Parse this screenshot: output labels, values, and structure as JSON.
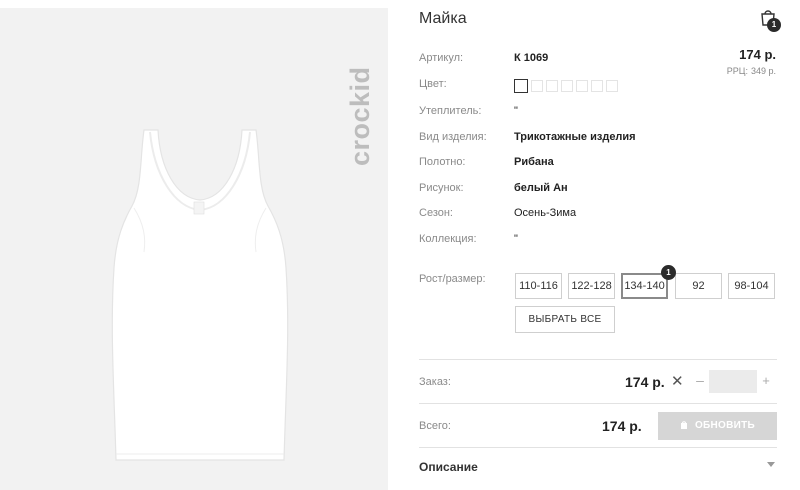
{
  "product": {
    "title": "Майка",
    "brand": "crockid",
    "price": "174 р.",
    "rrp_label": "РРЦ:",
    "rrp_value": "349 р."
  },
  "cart": {
    "badge_count": "1"
  },
  "attributes": [
    {
      "label": "Артикул:",
      "value": "К 1069",
      "bold": true
    },
    {
      "label": "Цвет:",
      "value": ""
    },
    {
      "label": "Утеплитель:",
      "value": "\""
    },
    {
      "label": "Вид изделия:",
      "value": "Трикотажные изделия",
      "bold": true
    },
    {
      "label": "Полотно:",
      "value": "Рибана",
      "bold": true
    },
    {
      "label": "Рисунок:",
      "value": "белый Ан",
      "bold": true
    },
    {
      "label": "Сезон:",
      "value": "Осень-Зима"
    },
    {
      "label": "Коллекция:",
      "value": "\""
    }
  ],
  "colors": {
    "swatch_count": 7,
    "selected_index": 0
  },
  "sizes": {
    "label": "Рост/размер:",
    "options": [
      "110-116",
      "122-128",
      "134-140",
      "92",
      "98-104"
    ],
    "selected": "134-140",
    "selected_badge": "1",
    "select_all_label": "ВЫБРАТЬ ВСЕ"
  },
  "order": {
    "label": "Заказ:",
    "price": "174 р.",
    "times_symbol": "✕",
    "minus": "–",
    "plus": "+",
    "quantity": ""
  },
  "total": {
    "label": "Всего:",
    "price": "174 р.",
    "update_label": "ОБНОВИТЬ"
  },
  "description": {
    "label": "Описание"
  }
}
